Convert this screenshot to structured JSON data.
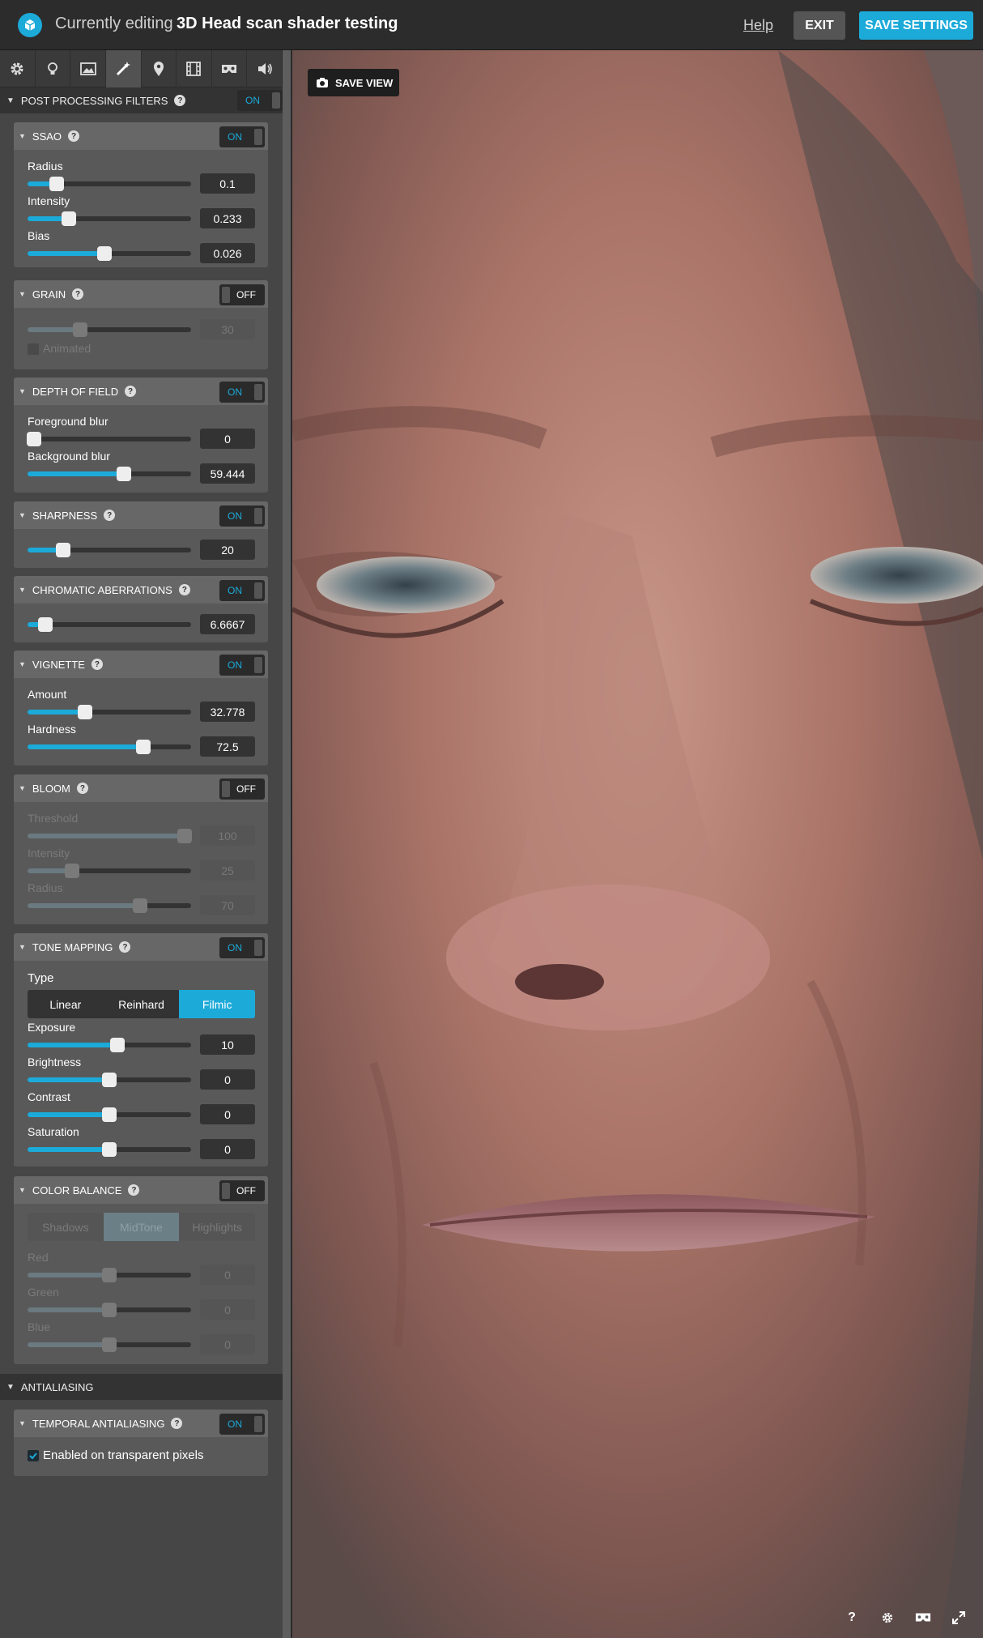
{
  "header": {
    "prefix": "Currently editing",
    "model_name": "3D Head scan shader testing",
    "help": "Help",
    "exit": "EXIT",
    "save": "SAVE SETTINGS"
  },
  "tabs": [
    "gear-icon",
    "bulb-icon",
    "image-icon",
    "wand-icon",
    "pin-icon",
    "film-icon",
    "vr-icon",
    "sound-icon"
  ],
  "post": {
    "title": "POST PROCESSING FILTERS",
    "toggle": "ON"
  },
  "ssao": {
    "title": "SSAO",
    "toggle": "ON",
    "radius_label": "Radius",
    "radius": "0.1",
    "radius_pct": 18,
    "intensity_label": "Intensity",
    "intensity": "0.233",
    "intensity_pct": 25,
    "bias_label": "Bias",
    "bias": "0.026",
    "bias_pct": 47
  },
  "grain": {
    "title": "GRAIN",
    "toggle": "OFF",
    "value": "30",
    "pct": 32,
    "animated": "Animated"
  },
  "dof": {
    "title": "DEPTH OF FIELD",
    "toggle": "ON",
    "fg_label": "Foreground blur",
    "fg": "0",
    "fg_pct": 4,
    "bg_label": "Background blur",
    "bg": "59.444",
    "bg_pct": 59
  },
  "sharpness": {
    "title": "SHARPNESS",
    "toggle": "ON",
    "value": "20",
    "pct": 22
  },
  "chroma": {
    "title": "CHROMATIC ABERRATIONS",
    "toggle": "ON",
    "value": "6.6667",
    "pct": 11
  },
  "vignette": {
    "title": "VIGNETTE",
    "toggle": "ON",
    "amount_label": "Amount",
    "amount": "32.778",
    "amount_pct": 35,
    "hardness_label": "Hardness",
    "hardness": "72.5",
    "hardness_pct": 71
  },
  "bloom": {
    "title": "BLOOM",
    "toggle": "OFF",
    "threshold_label": "Threshold",
    "threshold": "100",
    "threshold_pct": 96,
    "intensity_label": "Intensity",
    "intensity": "25",
    "intensity_pct": 27,
    "radius_label": "Radius",
    "radius": "70",
    "radius_pct": 69
  },
  "tone": {
    "title": "TONE MAPPING",
    "toggle": "ON",
    "type_label": "Type",
    "types": [
      "Linear",
      "Reinhard",
      "Filmic"
    ],
    "selected": 2,
    "exposure_label": "Exposure",
    "exposure": "10",
    "exposure_pct": 55,
    "brightness_label": "Brightness",
    "brightness": "0",
    "brightness_pct": 50,
    "contrast_label": "Contrast",
    "contrast": "0",
    "contrast_pct": 50,
    "saturation_label": "Saturation",
    "saturation": "0",
    "saturation_pct": 50
  },
  "color": {
    "title": "COLOR BALANCE",
    "toggle": "OFF",
    "modes": [
      "Shadows",
      "MidTone",
      "Highlights"
    ],
    "selected": 1,
    "red_label": "Red",
    "red": "0",
    "red_pct": 50,
    "green_label": "Green",
    "green": "0",
    "green_pct": 50,
    "blue_label": "Blue",
    "blue": "0",
    "blue_pct": 50
  },
  "aa": {
    "title": "ANTIALIASING"
  },
  "taa": {
    "title": "TEMPORAL ANTIALIASING",
    "toggle": "ON",
    "transparent": "Enabled on transparent pixels"
  },
  "viewport": {
    "save_view": "SAVE VIEW",
    "icons": [
      "help-icon",
      "settings-icon",
      "vr-icon",
      "fullscreen-icon"
    ],
    "help_glyph": "?"
  },
  "colors": {
    "accent": "#1caad9",
    "panel": "#464646",
    "card": "#595959"
  }
}
